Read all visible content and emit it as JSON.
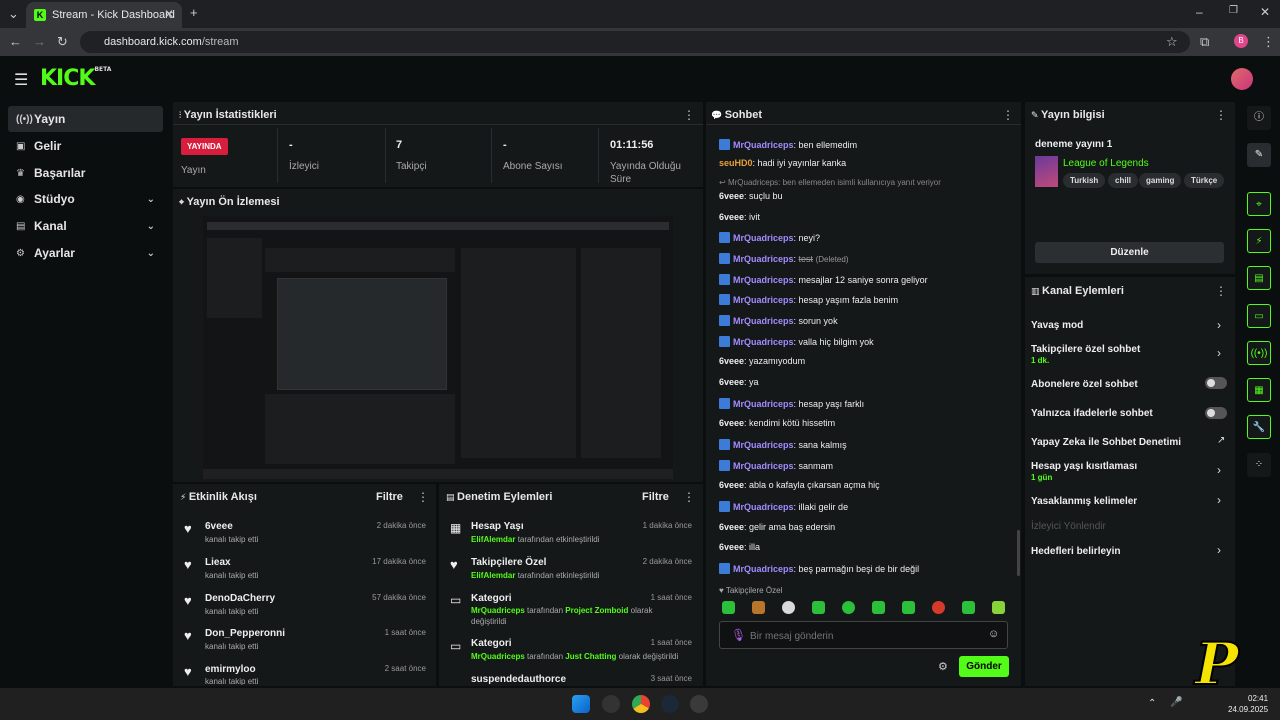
{
  "browser": {
    "tab_title": "Stream - Kick Dashboard",
    "url_host": "dashboard.kick.com",
    "url_path": "/stream"
  },
  "app": {
    "logo": "KICK",
    "logo_badge": "BETA"
  },
  "sidebar": {
    "items": [
      {
        "label": "Yayın",
        "icon": "broadcast-icon"
      },
      {
        "label": "Gelir",
        "icon": "wallet-icon"
      },
      {
        "label": "Başarılar",
        "icon": "trophy-icon"
      },
      {
        "label": "Stüdyo",
        "icon": "studio-icon"
      },
      {
        "label": "Kanal",
        "icon": "channel-icon"
      },
      {
        "label": "Ayarlar",
        "icon": "gear-icon"
      }
    ]
  },
  "stats": {
    "title": "Yayın İstatistikleri",
    "live_badge": "YAYINDA",
    "live_label": "Yayın",
    "viewers_value": "-",
    "viewers_label": "İzleyici",
    "followers_value": "7",
    "followers_label": "Takipçi",
    "subs_value": "-",
    "subs_label": "Abone Sayısı",
    "uptime_value": "01:11:56",
    "uptime_label_1": "Yayında Olduğu",
    "uptime_label_2": "Süre"
  },
  "preview": {
    "title": "Yayın Ön İzlemesi"
  },
  "activity": {
    "title": "Etkinlik Akışı",
    "filter": "Filtre",
    "items": [
      {
        "name": "6veee",
        "sub": "kanalı takip etti",
        "time": "2 dakika önce"
      },
      {
        "name": "Lieax",
        "sub": "kanalı takip etti",
        "time": "17 dakika önce"
      },
      {
        "name": "DenoDaCherry",
        "sub": "kanalı takip etti",
        "time": "57 dakika önce"
      },
      {
        "name": "Don_Pepperonni",
        "sub": "kanalı takip etti",
        "time": "1 saat önce"
      },
      {
        "name": "emirmyloo",
        "sub": "kanalı takip etti",
        "time": "2 saat önce"
      }
    ]
  },
  "moderation": {
    "title": "Denetim Eylemleri",
    "filter": "Filtre",
    "items": [
      {
        "name": "Hesap Yaşı",
        "actor": "ElifAlemdar",
        "text": "tarafından etkinleştirildi",
        "time": "1 dakika önce"
      },
      {
        "name": "Takipçilere Özel",
        "actor": "ElifAlemdar",
        "text": "tarafından etkinleştirildi",
        "time": "2 dakika önce"
      },
      {
        "name": "Kategori",
        "actor": "MrQuadriceps",
        "text": "tarafından",
        "target": "Project Zomboid",
        "text2": "olarak",
        "text3": "değiştirildi",
        "time": "1 saat önce"
      },
      {
        "name": "Kategori",
        "actor": "MrQuadriceps",
        "text": "tarafından",
        "target": "Just Chatting",
        "text2": "olarak değiştirildi",
        "time": "1 saat önce"
      },
      {
        "name": "suspendedauthorce",
        "time": "3 saat önce"
      }
    ]
  },
  "chat": {
    "title": "Sohbet",
    "reply_note": "MrQuadriceps: ben ellemeden isimli kullanıcıya yanıt veriyor",
    "messages": [
      {
        "user": "MrQuadriceps",
        "text": "ben ellemedim",
        "type": "blue"
      },
      {
        "user": "seuHD0",
        "text": "hadi iyi yayınlar kanka",
        "type": "orange"
      },
      {
        "user": "6veee",
        "text": "suçlu bu",
        "type": "plain"
      },
      {
        "user": "6veee",
        "text": "ivit",
        "type": "plain"
      },
      {
        "user": "MrQuadriceps",
        "text": "neyi?",
        "type": "blue"
      },
      {
        "user": "MrQuadriceps",
        "text": "test",
        "deleted": "(Deleted)",
        "type": "blue"
      },
      {
        "user": "MrQuadriceps",
        "text": "mesajlar 12 saniye sonra geliyor",
        "type": "blue"
      },
      {
        "user": "MrQuadriceps",
        "text": "hesap yaşım fazla benim",
        "type": "blue"
      },
      {
        "user": "MrQuadriceps",
        "text": "sorun yok",
        "type": "blue"
      },
      {
        "user": "MrQuadriceps",
        "text": "valla hiç bilgim yok",
        "type": "blue"
      },
      {
        "user": "6veee",
        "text": "yazamıyodum",
        "type": "plain"
      },
      {
        "user": "6veee",
        "text": "ya",
        "type": "plain"
      },
      {
        "user": "MrQuadriceps",
        "text": "hesap yaşı farklı",
        "type": "blue"
      },
      {
        "user": "6veee",
        "text": "kendimi kötü hissetim",
        "type": "plain"
      },
      {
        "user": "MrQuadriceps",
        "text": "sana kalmış",
        "type": "blue"
      },
      {
        "user": "MrQuadriceps",
        "text": "sanmam",
        "type": "blue"
      },
      {
        "user": "6veee",
        "text": "abla o kafayla çıkarsan açma hiç",
        "type": "plain"
      },
      {
        "user": "MrQuadriceps",
        "text": "illaki gelir de",
        "type": "blue"
      },
      {
        "user": "6veee",
        "text": "gelir ama baş edersin",
        "type": "plain"
      },
      {
        "user": "6veee",
        "text": "illa",
        "type": "plain"
      },
      {
        "user": "MrQuadriceps",
        "text": "beş parmağın beşi de bir değil",
        "type": "blue"
      }
    ],
    "mode_note": "Takipçilere Özel",
    "placeholder": "Bir mesaj gönderin",
    "send": "Gönder"
  },
  "stream_info": {
    "title": "Yayın bilgisi",
    "stream_title": "deneme yayını 1",
    "category": "League of Legends",
    "tags": [
      "Turkish",
      "chill",
      "gaming",
      "Türkçe"
    ],
    "edit": "Düzenle"
  },
  "channel_actions": {
    "title": "Kanal Eylemleri",
    "items": [
      {
        "label": "Yavaş mod",
        "control": "arrow"
      },
      {
        "label": "Takipçilere özel sohbet",
        "sub": "1 dk.",
        "control": "arrow"
      },
      {
        "label": "Abonelere özel sohbet",
        "control": "toggle"
      },
      {
        "label": "Yalnızca ifadelerle sohbet",
        "control": "toggle"
      },
      {
        "label": "Yapay Zeka ile Sohbet Denetimi",
        "control": "external"
      },
      {
        "label": "Hesap yaşı kısıtlaması",
        "sub": "1 gün",
        "control": "arrow"
      },
      {
        "label": "Yasaklanmış kelimeler",
        "control": "arrow"
      },
      {
        "label": "İzleyici Yönlendir",
        "control": "none"
      },
      {
        "label": "Hedefleri belirleyin",
        "control": "arrow"
      }
    ]
  },
  "taskbar": {
    "time": "02:41",
    "date": "24.09.2025"
  }
}
